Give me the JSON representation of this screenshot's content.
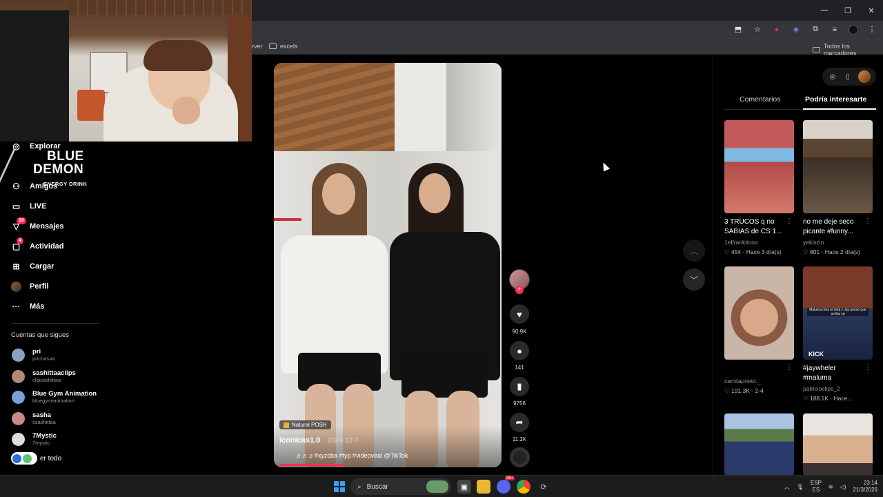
{
  "browser": {
    "bookmarks": [
      {
        "label": "rver"
      },
      {
        "label": "excels"
      },
      {
        "label": "Todos los marcadores"
      }
    ]
  },
  "sponsor": {
    "line1": "BLUE",
    "line2": "DEMON",
    "line3": "ENERGY DRINK"
  },
  "nav": {
    "items": [
      {
        "label": "Explorar",
        "icon": "compass-icon"
      },
      {
        "label": "Amigos",
        "icon": "friends-icon"
      },
      {
        "label": "LIVE",
        "icon": "live-icon"
      },
      {
        "label": "Mensajes",
        "icon": "messages-icon",
        "badge": "10"
      },
      {
        "label": "Actividad",
        "icon": "activity-icon",
        "badge": "4"
      },
      {
        "label": "Cargar",
        "icon": "upload-icon"
      },
      {
        "label": "Perfil",
        "icon": "profile-icon"
      },
      {
        "label": "Más",
        "icon": "more-icon"
      }
    ]
  },
  "following": {
    "title": "Cuentas que sigues",
    "accounts": [
      {
        "name": "pri",
        "handle": "prichasaa"
      },
      {
        "name": "sashittaaclips",
        "handle": "clipsashittaa"
      },
      {
        "name": "Blue Gym Animation",
        "handle": "bluegymanimation"
      },
      {
        "name": "sasha",
        "handle": "ssashittaa"
      },
      {
        "name": "7Mystic",
        "handle": "7mystic"
      }
    ],
    "see_all": "er todo"
  },
  "video": {
    "tag": "Natural POSH",
    "author": "iconicas1.0",
    "date": "· 2024-12-7",
    "caption": "♬♬♬#xyzcba #fyp #videoviral @TikTok",
    "progress": 0.3
  },
  "actions": {
    "likes": "90.9K",
    "comments": "141",
    "saves": "9756",
    "shares": "11.2K"
  },
  "panel": {
    "tabs": [
      "Comentarios",
      "Podría interesarte"
    ],
    "active_tab": "Podría interesarte",
    "cards": [
      {
        "title": "3 TRUCOS q no SABIAS de CS 1...",
        "user": "1elfrankitooo",
        "stats": "♡ 454 · Hace 3 día(s)"
      },
      {
        "title": "no me deje seco picante #funny...",
        "user": "yekiszin",
        "stats": "♡ 801 · Hace 2 día(s)"
      },
      {
        "title": "",
        "user": "camilaprieto._",
        "stats": "♡ 191.3K · 2-4"
      },
      {
        "title": "#jaywheler #maluma",
        "user": "patricioclips_2",
        "stats": "♡ 188.1K · Hace..."
      },
      {
        "title": "",
        "user": "",
        "stats": ""
      },
      {
        "title": "",
        "user": "",
        "stats": ""
      }
    ],
    "thumb_text": {
      "card4_caption": "Maluma mira el reloj y Jay pensó que se iba ya",
      "card4_brand": "KICK"
    }
  },
  "taskbar": {
    "search_placeholder": "Buscar",
    "lang": "ESP",
    "lang_sub": "ES",
    "time": "23:14",
    "date": "21/3/2026",
    "notif": "99+"
  },
  "colors": {
    "accent": "#fe2c55",
    "bg": "#000000",
    "chrome": "#35363a"
  }
}
